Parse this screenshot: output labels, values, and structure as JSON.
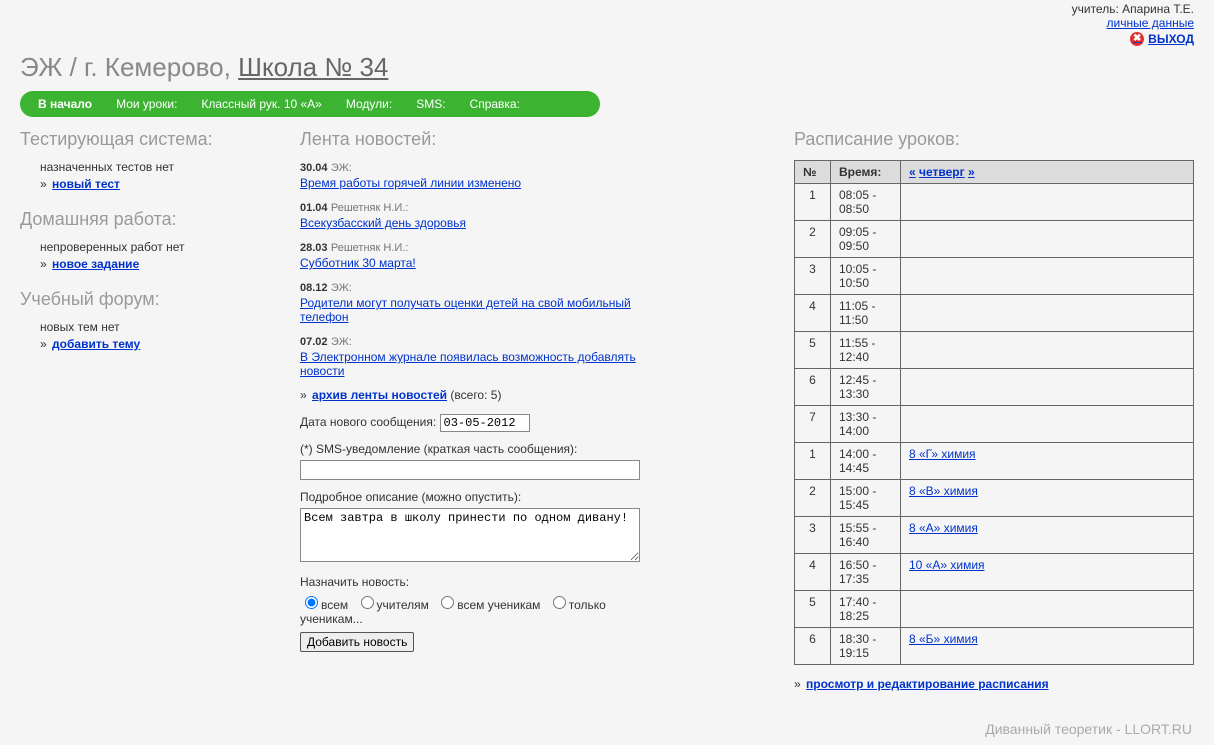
{
  "topbar": {
    "teacher_prefix": "учитель:",
    "teacher_name": "Апарина Т.Е.",
    "personal_label": "личные данные",
    "exit_label": "ВЫХОД"
  },
  "header": {
    "prefix": "ЭЖ / г. Кемерово,",
    "school_link": "Школа № 34"
  },
  "nav": {
    "home": "В начало",
    "lessons": "Мои уроки:",
    "class": "Классный рук. 10 «А»",
    "modules": "Модули:",
    "sms": "SMS:",
    "help": "Справка:"
  },
  "left": {
    "testing_title": "Тестирующая система:",
    "no_tests": "назначенных тестов нет",
    "new_test": "новый тест",
    "hw_title": "Домашняя работа:",
    "no_hw": "непроверенных работ нет",
    "new_hw": "новое задание",
    "forum_title": "Учебный форум:",
    "no_topics": "новых тем нет",
    "new_topic": "добавить тему"
  },
  "news": {
    "title": "Лента новостей:",
    "items": [
      {
        "date": "30.04",
        "src": "ЭЖ:",
        "link": "Время работы горячей линии изменено"
      },
      {
        "date": "01.04",
        "src": "Решетняк Н.И.:",
        "link": "Всекузбасский день здоровья"
      },
      {
        "date": "28.03",
        "src": "Решетняк Н.И.:",
        "link": "Субботник 30 марта!"
      },
      {
        "date": "08.12",
        "src": "ЭЖ:",
        "link": "Родители могут получать оценки детей на свой мобильный телефон"
      },
      {
        "date": "07.02",
        "src": "ЭЖ:",
        "link": "В Электронном журнале появилась возможность добавлять новости"
      }
    ],
    "archive_label": "архив ленты новостей",
    "archive_count": "(всего: 5)",
    "date_label": "Дата нового сообщения:",
    "date_value": "03-05-2012",
    "sms_label": "(*) SMS-уведомление (краткая часть сообщения):",
    "detail_label": "Подробное описание (можно опустить):",
    "detail_value": "Всем завтра в школу принести по одном дивану!",
    "assign_label": "Назначить новость:",
    "radios": {
      "all": "всем",
      "teachers": "учителям",
      "pupils": "всем ученикам",
      "pupils_only": "только ученикам..."
    },
    "submit": "Добавить новость"
  },
  "schedule": {
    "title": "Расписание уроков:",
    "head_num": "№",
    "head_time": "Время:",
    "day_prev": "«",
    "day_name": "четверг",
    "day_next": "»",
    "rows": [
      {
        "n": "1",
        "time": "08:05 - 08:50",
        "subj": ""
      },
      {
        "n": "2",
        "time": "09:05 - 09:50",
        "subj": ""
      },
      {
        "n": "3",
        "time": "10:05 - 10:50",
        "subj": ""
      },
      {
        "n": "4",
        "time": "11:05 - 11:50",
        "subj": ""
      },
      {
        "n": "5",
        "time": "11:55 - 12:40",
        "subj": ""
      },
      {
        "n": "6",
        "time": "12:45 - 13:30",
        "subj": ""
      },
      {
        "n": "7",
        "time": "13:30 - 14:00",
        "subj": ""
      },
      {
        "n": "1",
        "time": "14:00 - 14:45",
        "subj": "8 «Г» химия"
      },
      {
        "n": "2",
        "time": "15:00 - 15:45",
        "subj": "8 «В» химия"
      },
      {
        "n": "3",
        "time": "15:55 - 16:40",
        "subj": "8 «А» химия"
      },
      {
        "n": "4",
        "time": "16:50 - 17:35",
        "subj": "10 «А» химия"
      },
      {
        "n": "5",
        "time": "17:40 - 18:25",
        "subj": ""
      },
      {
        "n": "6",
        "time": "18:30 - 19:15",
        "subj": "8 «Б» химия"
      }
    ],
    "edit_link": "просмотр и редактирование расписания"
  },
  "footer": "Диванный теоретик - LLORT.RU"
}
